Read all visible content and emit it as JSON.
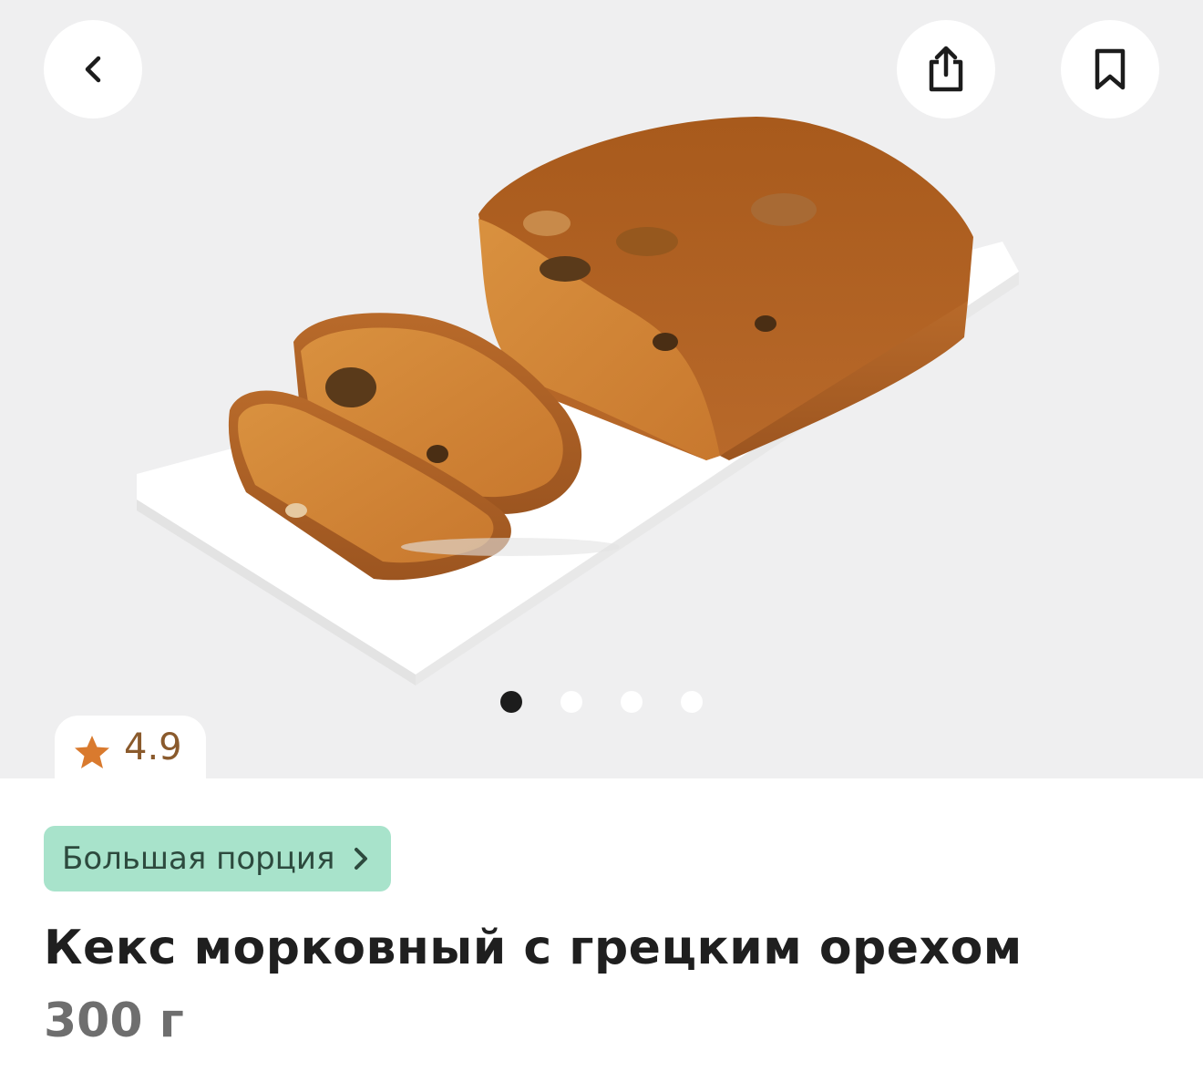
{
  "rating": {
    "value": "4.9",
    "icon": "star-icon",
    "color": "#d97a2e"
  },
  "header": {
    "back_icon": "chevron-left-icon",
    "share_icon": "share-icon",
    "bookmark_icon": "bookmark-icon"
  },
  "gallery": {
    "total": 4,
    "active": 1
  },
  "portion_chip": {
    "label": "Большая порция",
    "icon": "chevron-right-icon",
    "background": "#a8e3cb"
  },
  "product": {
    "title": "Кекс морковный с грецким орехом",
    "weight": "300 г"
  }
}
